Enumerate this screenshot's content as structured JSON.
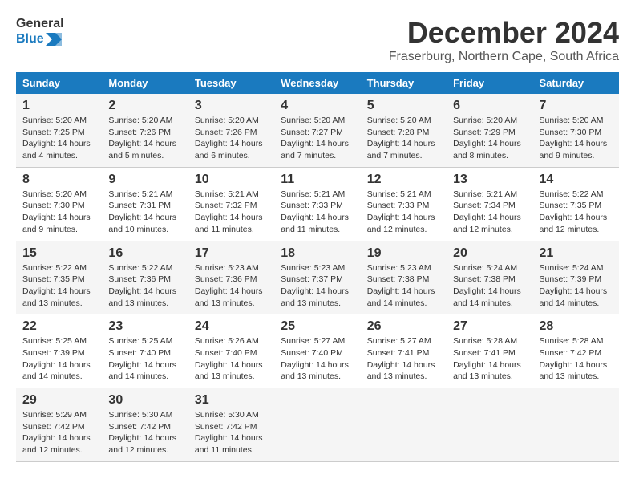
{
  "header": {
    "logo_line1": "General",
    "logo_line2": "Blue",
    "month_year": "December 2024",
    "location": "Fraserburg, Northern Cape, South Africa"
  },
  "days_of_week": [
    "Sunday",
    "Monday",
    "Tuesday",
    "Wednesday",
    "Thursday",
    "Friday",
    "Saturday"
  ],
  "weeks": [
    [
      {
        "day": "1",
        "sunrise": "5:20 AM",
        "sunset": "7:25 PM",
        "daylight": "14 hours and 4 minutes."
      },
      {
        "day": "2",
        "sunrise": "5:20 AM",
        "sunset": "7:26 PM",
        "daylight": "14 hours and 5 minutes."
      },
      {
        "day": "3",
        "sunrise": "5:20 AM",
        "sunset": "7:26 PM",
        "daylight": "14 hours and 6 minutes."
      },
      {
        "day": "4",
        "sunrise": "5:20 AM",
        "sunset": "7:27 PM",
        "daylight": "14 hours and 7 minutes."
      },
      {
        "day": "5",
        "sunrise": "5:20 AM",
        "sunset": "7:28 PM",
        "daylight": "14 hours and 7 minutes."
      },
      {
        "day": "6",
        "sunrise": "5:20 AM",
        "sunset": "7:29 PM",
        "daylight": "14 hours and 8 minutes."
      },
      {
        "day": "7",
        "sunrise": "5:20 AM",
        "sunset": "7:30 PM",
        "daylight": "14 hours and 9 minutes."
      }
    ],
    [
      {
        "day": "8",
        "sunrise": "5:20 AM",
        "sunset": "7:30 PM",
        "daylight": "14 hours and 9 minutes."
      },
      {
        "day": "9",
        "sunrise": "5:21 AM",
        "sunset": "7:31 PM",
        "daylight": "14 hours and 10 minutes."
      },
      {
        "day": "10",
        "sunrise": "5:21 AM",
        "sunset": "7:32 PM",
        "daylight": "14 hours and 11 minutes."
      },
      {
        "day": "11",
        "sunrise": "5:21 AM",
        "sunset": "7:33 PM",
        "daylight": "14 hours and 11 minutes."
      },
      {
        "day": "12",
        "sunrise": "5:21 AM",
        "sunset": "7:33 PM",
        "daylight": "14 hours and 12 minutes."
      },
      {
        "day": "13",
        "sunrise": "5:21 AM",
        "sunset": "7:34 PM",
        "daylight": "14 hours and 12 minutes."
      },
      {
        "day": "14",
        "sunrise": "5:22 AM",
        "sunset": "7:35 PM",
        "daylight": "14 hours and 12 minutes."
      }
    ],
    [
      {
        "day": "15",
        "sunrise": "5:22 AM",
        "sunset": "7:35 PM",
        "daylight": "14 hours and 13 minutes."
      },
      {
        "day": "16",
        "sunrise": "5:22 AM",
        "sunset": "7:36 PM",
        "daylight": "14 hours and 13 minutes."
      },
      {
        "day": "17",
        "sunrise": "5:23 AM",
        "sunset": "7:36 PM",
        "daylight": "14 hours and 13 minutes."
      },
      {
        "day": "18",
        "sunrise": "5:23 AM",
        "sunset": "7:37 PM",
        "daylight": "14 hours and 13 minutes."
      },
      {
        "day": "19",
        "sunrise": "5:23 AM",
        "sunset": "7:38 PM",
        "daylight": "14 hours and 14 minutes."
      },
      {
        "day": "20",
        "sunrise": "5:24 AM",
        "sunset": "7:38 PM",
        "daylight": "14 hours and 14 minutes."
      },
      {
        "day": "21",
        "sunrise": "5:24 AM",
        "sunset": "7:39 PM",
        "daylight": "14 hours and 14 minutes."
      }
    ],
    [
      {
        "day": "22",
        "sunrise": "5:25 AM",
        "sunset": "7:39 PM",
        "daylight": "14 hours and 14 minutes."
      },
      {
        "day": "23",
        "sunrise": "5:25 AM",
        "sunset": "7:40 PM",
        "daylight": "14 hours and 14 minutes."
      },
      {
        "day": "24",
        "sunrise": "5:26 AM",
        "sunset": "7:40 PM",
        "daylight": "14 hours and 13 minutes."
      },
      {
        "day": "25",
        "sunrise": "5:27 AM",
        "sunset": "7:40 PM",
        "daylight": "14 hours and 13 minutes."
      },
      {
        "day": "26",
        "sunrise": "5:27 AM",
        "sunset": "7:41 PM",
        "daylight": "14 hours and 13 minutes."
      },
      {
        "day": "27",
        "sunrise": "5:28 AM",
        "sunset": "7:41 PM",
        "daylight": "14 hours and 13 minutes."
      },
      {
        "day": "28",
        "sunrise": "5:28 AM",
        "sunset": "7:42 PM",
        "daylight": "14 hours and 13 minutes."
      }
    ],
    [
      {
        "day": "29",
        "sunrise": "5:29 AM",
        "sunset": "7:42 PM",
        "daylight": "14 hours and 12 minutes."
      },
      {
        "day": "30",
        "sunrise": "5:30 AM",
        "sunset": "7:42 PM",
        "daylight": "14 hours and 12 minutes."
      },
      {
        "day": "31",
        "sunrise": "5:30 AM",
        "sunset": "7:42 PM",
        "daylight": "14 hours and 11 minutes."
      },
      null,
      null,
      null,
      null
    ]
  ],
  "labels": {
    "sunrise": "Sunrise:",
    "sunset": "Sunset:",
    "daylight": "Daylight:"
  }
}
